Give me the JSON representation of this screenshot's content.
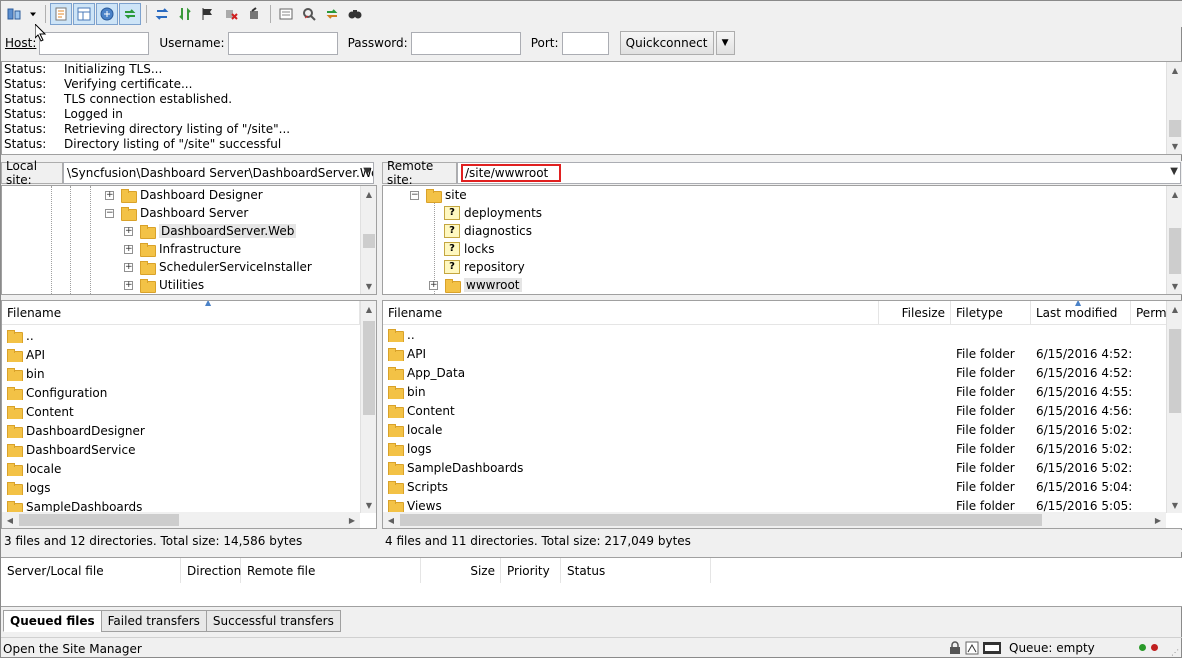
{
  "toolbar": {
    "icons": [
      "site-manager-icon",
      "dropdown-arrow-icon",
      "toggle-log-icon",
      "toggle-local-tree-icon",
      "toggle-remote-tree-icon",
      "toggle-queue-icon",
      "refresh-icon",
      "process-queue-icon",
      "cancel-operation-icon",
      "disconnect-icon",
      "reconnect-icon",
      "directory-listing-filters-icon",
      "compare-directories-icon",
      "sync-browsing-icon",
      "search-files-icon"
    ]
  },
  "quickconnect": {
    "host_label": "Host:",
    "username_label": "Username:",
    "password_label": "Password:",
    "port_label": "Port:",
    "host_value": "",
    "username_value": "",
    "password_value": "",
    "port_value": "",
    "button_label": "Quickconnect"
  },
  "log": {
    "rows": [
      {
        "k": "Status:",
        "v": "Initializing TLS..."
      },
      {
        "k": "Status:",
        "v": "Verifying certificate..."
      },
      {
        "k": "Status:",
        "v": "TLS connection established."
      },
      {
        "k": "Status:",
        "v": "Logged in"
      },
      {
        "k": "Status:",
        "v": "Retrieving directory listing of \"/site\"..."
      },
      {
        "k": "Status:",
        "v": "Directory listing of \"/site\" successful"
      }
    ]
  },
  "local": {
    "site_label": "Local site:",
    "site_path": "\\Syncfusion\\Dashboard Server\\DashboardServer.Web\\",
    "tree": [
      {
        "label": "Dashboard Designer",
        "pm": "+"
      },
      {
        "label": "Dashboard Server",
        "pm": "−"
      },
      {
        "label": "DashboardServer.Web",
        "pm": "+"
      },
      {
        "label": "Infrastructure",
        "pm": "+"
      },
      {
        "label": "SchedulerServiceInstaller",
        "pm": "+"
      },
      {
        "label": "Utilities",
        "pm": "+"
      }
    ],
    "col_filename": "Filename",
    "files": [
      "..",
      "API",
      "bin",
      "Configuration",
      "Content",
      "DashboardDesigner",
      "DashboardService",
      "locale",
      "logs",
      "SampleDashboards"
    ],
    "summary": "3 files and 12 directories. Total size: 14,586 bytes"
  },
  "remote": {
    "site_label": "Remote site:",
    "site_path": "/site/wwwroot",
    "tree": [
      {
        "label": "site",
        "pm": "−",
        "type": "folder"
      },
      {
        "label": "deployments",
        "type": "unknown"
      },
      {
        "label": "diagnostics",
        "type": "unknown"
      },
      {
        "label": "locks",
        "type": "unknown"
      },
      {
        "label": "repository",
        "type": "unknown"
      },
      {
        "label": "wwwroot",
        "pm": "+",
        "type": "folder"
      }
    ],
    "columns": {
      "filename": "Filename",
      "filesize": "Filesize",
      "filetype": "Filetype",
      "modified": "Last modified",
      "perm": "Perm"
    },
    "files": [
      {
        "name": "..",
        "type": "",
        "modified": ""
      },
      {
        "name": "API",
        "type": "File folder",
        "modified": "6/15/2016 4:52:..."
      },
      {
        "name": "App_Data",
        "type": "File folder",
        "modified": "6/15/2016 4:52:..."
      },
      {
        "name": "bin",
        "type": "File folder",
        "modified": "6/15/2016 4:55:..."
      },
      {
        "name": "Content",
        "type": "File folder",
        "modified": "6/15/2016 4:56:..."
      },
      {
        "name": "locale",
        "type": "File folder",
        "modified": "6/15/2016 5:02:..."
      },
      {
        "name": "logs",
        "type": "File folder",
        "modified": "6/15/2016 5:02:..."
      },
      {
        "name": "SampleDashboards",
        "type": "File folder",
        "modified": "6/15/2016 5:02:..."
      },
      {
        "name": "Scripts",
        "type": "File folder",
        "modified": "6/15/2016 5:04:..."
      },
      {
        "name": "Views",
        "type": "File folder",
        "modified": "6/15/2016 5:05:..."
      }
    ],
    "summary": "4 files and 11 directories. Total size: 217,049 bytes"
  },
  "queue": {
    "columns": [
      "Server/Local file",
      "Direction",
      "Remote file",
      "Size",
      "Priority",
      "Status"
    ],
    "tabs": [
      "Queued files",
      "Failed transfers",
      "Successful transfers"
    ]
  },
  "statusbar": {
    "message": "Open the Site Manager",
    "queue": "Queue: empty"
  },
  "colors": {
    "highlight_border": "#e02020",
    "led_green": "#2a9a2a",
    "led_red": "#c02020"
  }
}
